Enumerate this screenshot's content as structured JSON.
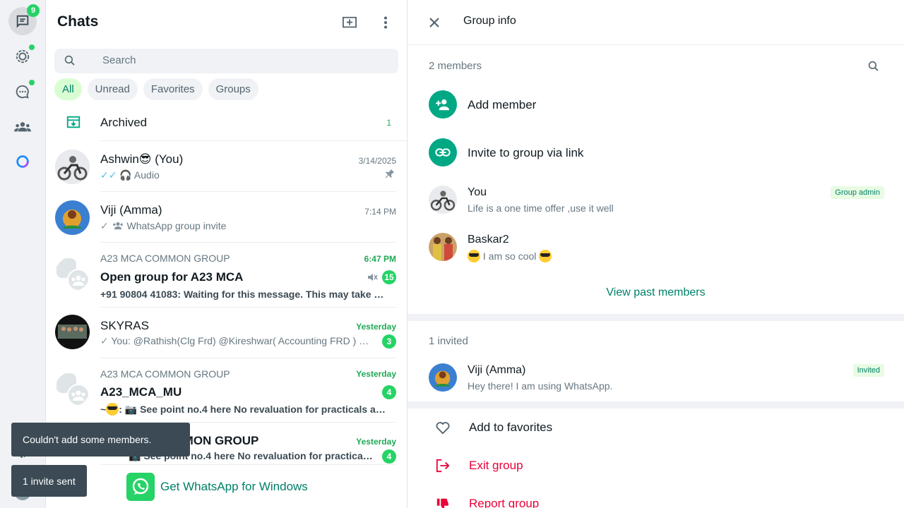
{
  "rail": {
    "chats_badge": "9"
  },
  "chats": {
    "title": "Chats",
    "search_placeholder": "Search",
    "filters": [
      "All",
      "Unread",
      "Favorites",
      "Groups"
    ],
    "archived": {
      "label": "Archived",
      "count": "1"
    },
    "items": [
      {
        "name": "Ashwin😎 (You)",
        "time": "3/14/2025",
        "preview": "Audio"
      },
      {
        "name": "Viji (Amma)",
        "time": "7:14 PM",
        "preview": "WhatsApp group invite"
      },
      {
        "group": "A23 MCA COMMON GROUP",
        "name": "Open group for A23 MCA",
        "time": "6:47 PM",
        "preview": "+91 90804 41083: Waiting for this message. This may take a while.",
        "count": "15"
      },
      {
        "name": "SKYRAS",
        "time": "Yesterday",
        "preview": "You: @Rathish(Clg Frd)  @Kireshwar( Accounting FRD )  …",
        "count": "3"
      },
      {
        "group": "A23 MCA COMMON GROUP",
        "name": "A23_MCA_MU",
        "time": "Yesterday",
        "preview_sender": "~",
        "preview": "See point no.4 here No revaluation for practicals and the fee details",
        "count": "4"
      },
      {
        "name": "COMMON GROUP",
        "time": "Yesterday",
        "preview": "See point no.4 here No revaluation for practicals and the fee details",
        "count": "4"
      }
    ],
    "get_app": "Get WhatsApp for Windows"
  },
  "toasts": {
    "error": "Couldn't add some members.",
    "invite": "1 invite sent"
  },
  "panel": {
    "title": "Group info",
    "members_label": "2 members",
    "add_member": "Add member",
    "invite_link": "Invite to group via link",
    "members": [
      {
        "name": "You",
        "status": "Life is a one time offer ,use it well",
        "tag": "Group admin"
      },
      {
        "name": "Baskar2",
        "status": "I am so cool"
      }
    ],
    "view_past": "View past members",
    "invited_label": "1 invited",
    "invited": {
      "name": "Viji (Amma)",
      "status": "Hey there! I am using WhatsApp.",
      "tag": "Invited"
    },
    "actions": {
      "favorite": "Add to favorites",
      "exit": "Exit group",
      "report": "Report group"
    }
  },
  "colors": {
    "accent": "#00a884",
    "badge": "#25d366",
    "danger": "#ea0038",
    "link": "#008069"
  }
}
